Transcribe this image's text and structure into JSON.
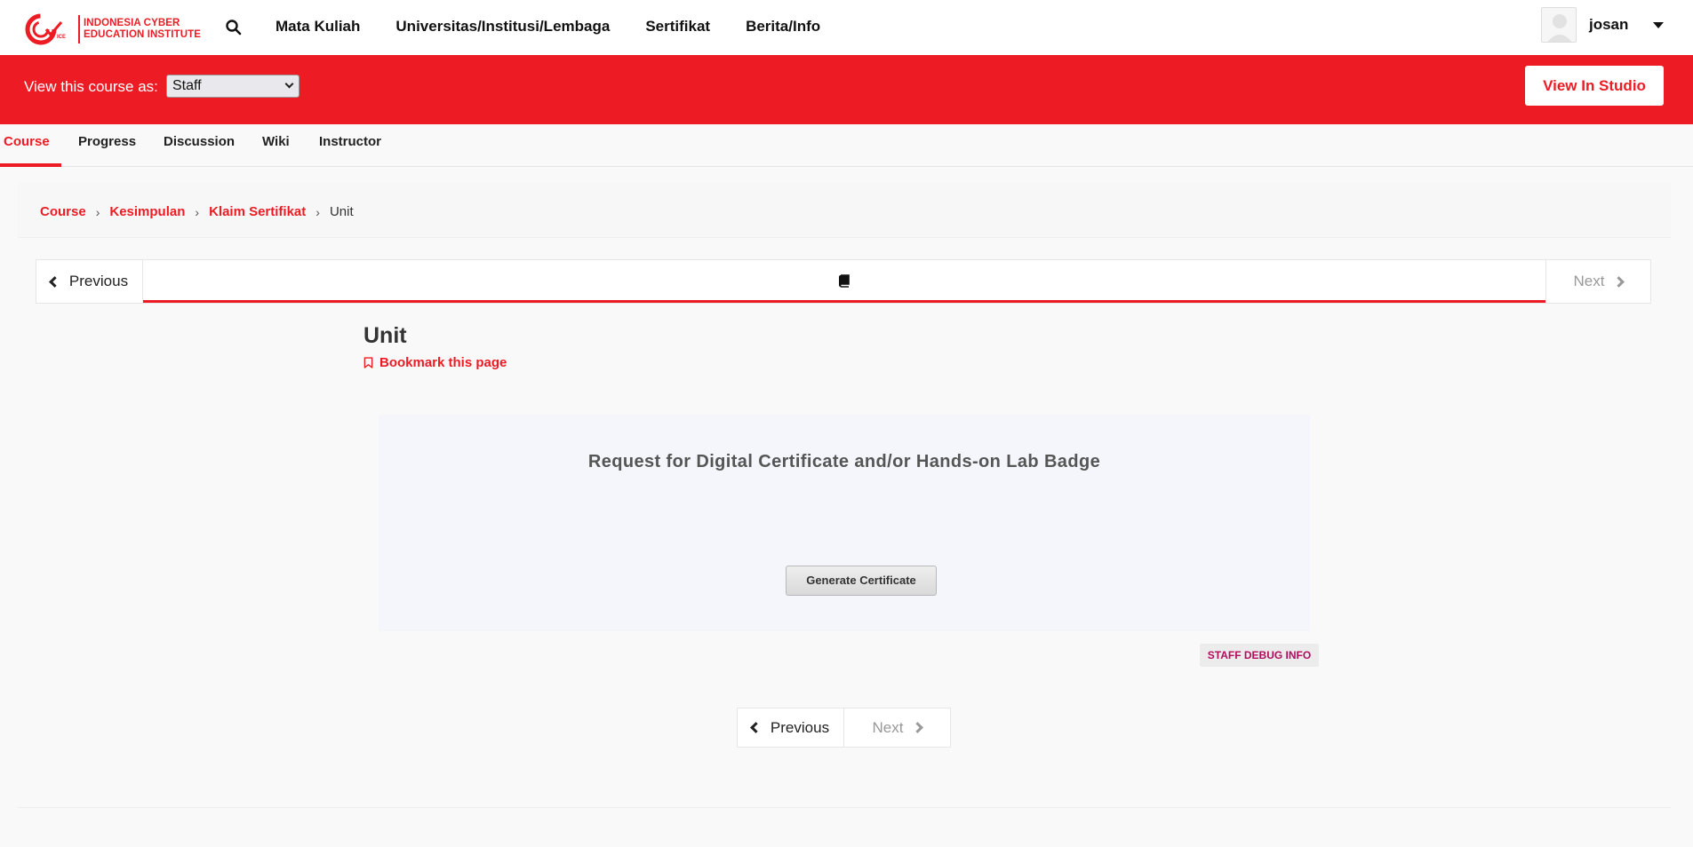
{
  "header": {
    "logo_line1": "INDONESIA CYBER",
    "logo_line2": "EDUCATION INSTITUTE",
    "nav": [
      "Mata Kuliah",
      "Universitas/Institusi/Lembaga",
      "Sertifikat",
      "Berita/Info"
    ],
    "username": "josan"
  },
  "staffbar": {
    "label": "View this course as:",
    "select_value": "Staff",
    "studio_button": "View In Studio"
  },
  "tabs": [
    "Course",
    "Progress",
    "Discussion",
    "Wiki",
    "Instructor"
  ],
  "active_tab": "Course",
  "breadcrumb": {
    "links": [
      "Course",
      "Kesimpulan",
      "Klaim Sertifikat"
    ],
    "current": "Unit"
  },
  "sequence": {
    "previous": "Previous",
    "next": "Next"
  },
  "unit": {
    "title": "Unit",
    "bookmark": "Bookmark this page"
  },
  "certificate": {
    "heading": "Request for Digital Certificate and/or Hands-on Lab Badge",
    "button": "Generate Certificate"
  },
  "debug": "STAFF DEBUG INFO",
  "bottom_nav": {
    "previous": "Previous",
    "next": "Next"
  },
  "colors": {
    "brand_red": "#ed1c24",
    "debug_text": "#b20d5c"
  }
}
